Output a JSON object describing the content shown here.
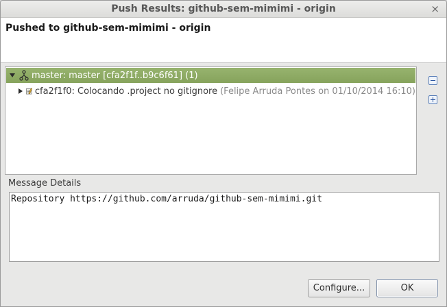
{
  "window": {
    "title": "Push Results: github-sem-mimimi - origin",
    "close_glyph": "×"
  },
  "header": {
    "heading": "Pushed to github-sem-mimimi - origin"
  },
  "tree": {
    "ref_row": {
      "label": "master: master [cfa2f1f..b9c6f61] (1)",
      "icon": "branch-icon",
      "expanded": true
    },
    "commit_row": {
      "label": "cfa2f1f0: Colocando .project no gitignore",
      "meta": "(Felipe Arruda Pontes on 01/10/2014 16:10)",
      "icon": "commit-icon",
      "expanded": false
    }
  },
  "side_buttons": {
    "collapse_icon": "collapse-all-icon",
    "expand_icon": "expand-all-icon"
  },
  "message": {
    "label": "Message Details",
    "text": "Repository https://github.com/arruda/github-sem-mimimi.git"
  },
  "buttons": {
    "configure": "Configure...",
    "ok": "OK"
  },
  "colors": {
    "selection": "#8fab66",
    "titlebar": "#e3e3e1",
    "background": "#e8e8e7"
  }
}
